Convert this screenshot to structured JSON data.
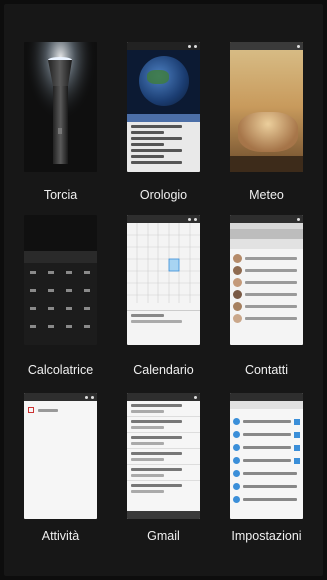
{
  "apps": [
    {
      "name": "Torcia",
      "icon": "flashlight-icon"
    },
    {
      "name": "Orologio",
      "icon": "clock-icon"
    },
    {
      "name": "Meteo",
      "icon": "weather-icon"
    },
    {
      "name": "Calcolatrice",
      "icon": "calculator-icon"
    },
    {
      "name": "Calendario",
      "icon": "calendar-icon"
    },
    {
      "name": "Contatti",
      "icon": "contacts-icon"
    },
    {
      "name": "Attività",
      "icon": "tasks-icon"
    },
    {
      "name": "Gmail",
      "icon": "mail-icon"
    },
    {
      "name": "Impostazioni",
      "icon": "settings-icon"
    }
  ],
  "colors": {
    "background": "#0d0d0d",
    "accent_blue": "#3b8fd9",
    "calculator": "#2a2a2a",
    "weather_sky": "#c89a5c"
  }
}
